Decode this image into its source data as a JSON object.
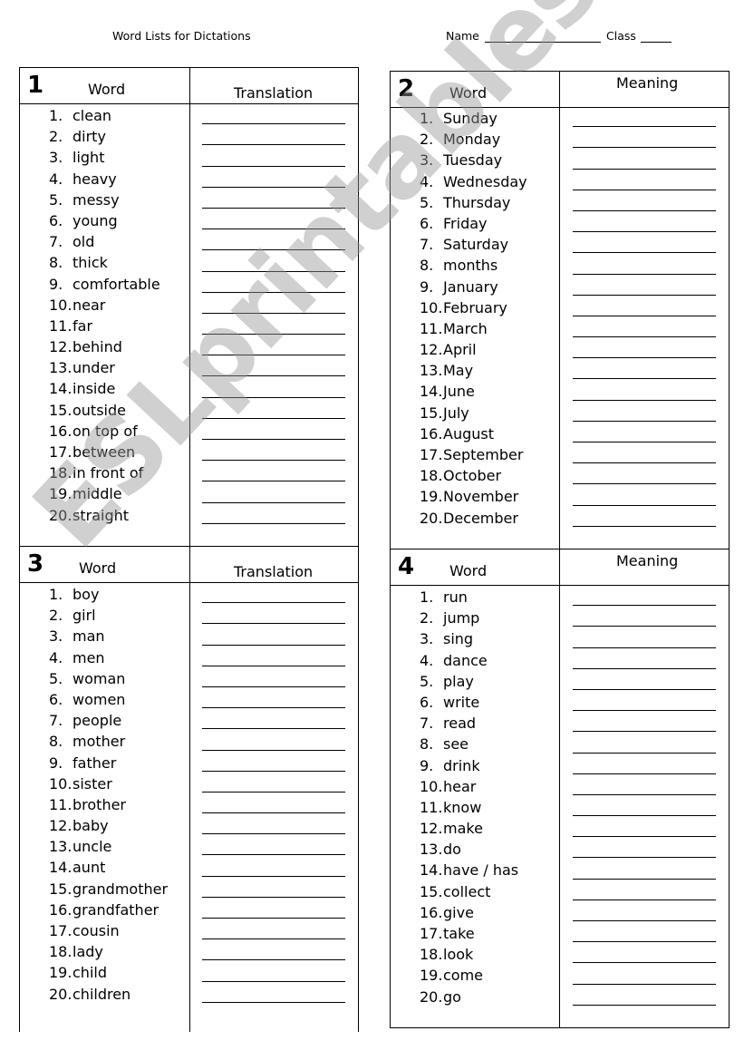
{
  "header": {
    "title": "Word Lists for Dictations",
    "name_label": "Name",
    "class_label": "Class"
  },
  "watermark": "ESLprintables.com",
  "lists": [
    {
      "number": "1",
      "word_heading": "Word",
      "second_heading": "Translation",
      "words": [
        "clean",
        "dirty",
        "light",
        "heavy",
        "messy",
        "young",
        "old",
        "thick",
        "comfortable",
        "near",
        "far",
        "behind",
        "under",
        "inside",
        "outside",
        "on top of",
        "between",
        "in front of",
        "middle",
        "straight"
      ]
    },
    {
      "number": "2",
      "word_heading": "Word",
      "second_heading": "Meaning",
      "words": [
        "Sunday",
        "Monday",
        "Tuesday",
        "Wednesday",
        "Thursday",
        "Friday",
        "Saturday",
        "months",
        "January",
        "February",
        "March",
        "April",
        "May",
        "June",
        "July",
        "August",
        "September",
        "October",
        "November",
        "December"
      ]
    },
    {
      "number": "3",
      "word_heading": "Word",
      "second_heading": "Translation",
      "words": [
        "boy",
        "girl",
        "man",
        "men",
        "woman",
        "women",
        "people",
        "mother",
        "father",
        "sister",
        "brother",
        "baby",
        "uncle",
        "aunt",
        "grandmother",
        "grandfather",
        "cousin",
        "lady",
        "child",
        "children"
      ]
    },
    {
      "number": "4",
      "word_heading": "Word",
      "second_heading": "Meaning",
      "words": [
        "run",
        "jump",
        "sing",
        "dance",
        "play",
        "write",
        "read",
        "see",
        "drink",
        "hear",
        "know",
        "make",
        "do",
        "have / has",
        "collect",
        "give",
        "take",
        "look",
        "come",
        "go"
      ]
    }
  ]
}
